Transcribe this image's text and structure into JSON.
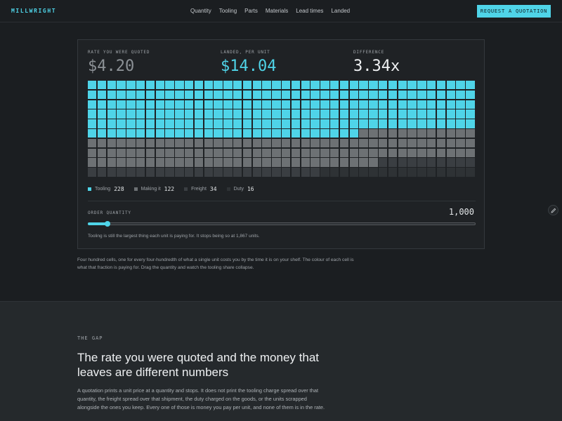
{
  "nav": {
    "logo": "MILLWRIGHT",
    "links": [
      "Quantity",
      "Tooling",
      "Parts",
      "Materials",
      "Lead times",
      "Landed"
    ],
    "cta": "REQUEST A QUOTATION"
  },
  "stats": {
    "quoted_label": "RATE YOU WERE QUOTED",
    "quoted_value": "$4.20",
    "landed_label": "LANDED, PER UNIT",
    "landed_value": "$14.04",
    "diff_label": "DIFFERENCE",
    "diff_value": "3.34x"
  },
  "colors": {
    "accent": "#4fd4e8",
    "making": "#6d7174",
    "freight": "#3a3e42",
    "duty": "#2e3235"
  },
  "breakdown": [
    {
      "name": "Tooling",
      "count": 228,
      "color": "#4fd4e8"
    },
    {
      "name": "Making it",
      "count": 122,
      "color": "#6d7174"
    },
    {
      "name": "Freight",
      "count": 34,
      "color": "#3a3e42"
    },
    {
      "name": "Duty",
      "count": 16,
      "color": "#2e3235"
    }
  ],
  "order": {
    "label": "ORDER QUANTITY",
    "value": "1,000",
    "slider_fraction": 0.05,
    "note": "Tooling is still the largest thing each unit is paying for. It stops being so at 1,867 units."
  },
  "caption": "Four hundred cells, one for every four-hundredth of what a single unit costs you by the time it is on your shelf. The colour of each cell is what that fraction is paying for. Drag the quantity and watch the tooling share collapse.",
  "section": {
    "eyebrow": "THE GAP",
    "headline": "The rate you were quoted and the money that leaves are different numbers",
    "body": "A quotation prints a unit price at a quantity and stops. It does not print the tooling charge spread over that quantity, the freight spread over that shipment, the duty charged on the goods, or the units scrapped alongside the ones you keep. Every one of those is money you pay per unit, and none of them is in the rate."
  },
  "icons": {
    "edit": "pencil-icon"
  }
}
